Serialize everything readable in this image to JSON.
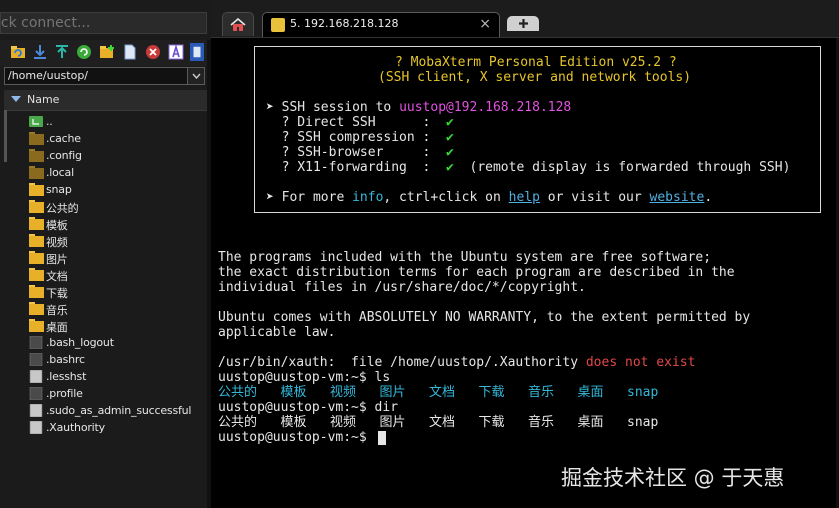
{
  "left_panel": {
    "quick_connect_placeholder": "ick connect...",
    "path": "/home/uustop/",
    "column_header": "Name",
    "files": [
      {
        "name": "..",
        "kind": "parent"
      },
      {
        "name": ".cache",
        "kind": "folder-hidden"
      },
      {
        "name": ".config",
        "kind": "folder-hidden"
      },
      {
        "name": ".local",
        "kind": "folder-hidden"
      },
      {
        "name": "snap",
        "kind": "folder"
      },
      {
        "name": "公共的",
        "kind": "folder"
      },
      {
        "name": "模板",
        "kind": "folder"
      },
      {
        "name": "视频",
        "kind": "folder"
      },
      {
        "name": "图片",
        "kind": "folder"
      },
      {
        "name": "文档",
        "kind": "folder"
      },
      {
        "name": "下载",
        "kind": "folder"
      },
      {
        "name": "音乐",
        "kind": "folder"
      },
      {
        "name": "桌面",
        "kind": "folder"
      },
      {
        "name": ".bash_logout",
        "kind": "file-dark"
      },
      {
        "name": ".bashrc",
        "kind": "file-dark"
      },
      {
        "name": ".lesshst",
        "kind": "file"
      },
      {
        "name": ".profile",
        "kind": "file-dark"
      },
      {
        "name": ".sudo_as_admin_successful",
        "kind": "file"
      },
      {
        "name": ".Xauthority",
        "kind": "file"
      }
    ]
  },
  "tabs": {
    "active_label": "5. 192.168.218.128",
    "close_glyph": "×"
  },
  "banner": {
    "title": "? MobaXterm Personal Edition v25.2 ?",
    "subtitle": "(SSH client, X server and network tools)",
    "session_prefix": "➤ SSH session to ",
    "session_target": "uustop@192.168.218.128",
    "features": [
      {
        "label": "  ? Direct SSH      :  ",
        "check": "✔",
        "note": ""
      },
      {
        "label": "  ? SSH compression :  ",
        "check": "✔",
        "note": ""
      },
      {
        "label": "  ? SSH-browser     :  ",
        "check": "✔",
        "note": ""
      },
      {
        "label": "  ? X11-forwarding  :  ",
        "check": "✔",
        "note": "  (remote display is forwarded through SSH)"
      }
    ],
    "more_prefix": "➤ For more ",
    "more_info": "info",
    "more_mid": ", ctrl+click on ",
    "more_help": "help",
    "more_or": " or visit our ",
    "more_website": "website",
    "more_end": "."
  },
  "terminal": {
    "lines": [
      "The programs included with the Ubuntu system are free software;",
      "the exact distribution terms for each program are described in the",
      "individual files in /usr/share/doc/*/copyright.",
      "",
      "Ubuntu comes with ABSOLUTELY NO WARRANTY, to the extent permitted by",
      "applicable law."
    ],
    "xauth_prefix": "/usr/bin/xauth:  file /home/uustop/.Xauthority ",
    "xauth_error": "does not exist",
    "prompt": "uustop@uustop-vm:~$ ",
    "cmd1": "ls",
    "ls_output": [
      "公共的",
      "模板",
      "视频",
      "图片",
      "文档",
      "下载",
      "音乐",
      "桌面",
      "snap"
    ],
    "cmd2": "dir",
    "dir_output": [
      "公共的",
      "模板",
      "视频",
      "图片",
      "文档",
      "下载",
      "音乐",
      "桌面",
      "snap"
    ]
  },
  "watermark": "掘金技术社区 @ 于天惠",
  "colors": {
    "accent_yellow": "#e6c52a",
    "magenta": "#e052e0",
    "green_check": "#33dd33",
    "cyan_dir": "#33b8d8",
    "error_red": "#e04848"
  }
}
